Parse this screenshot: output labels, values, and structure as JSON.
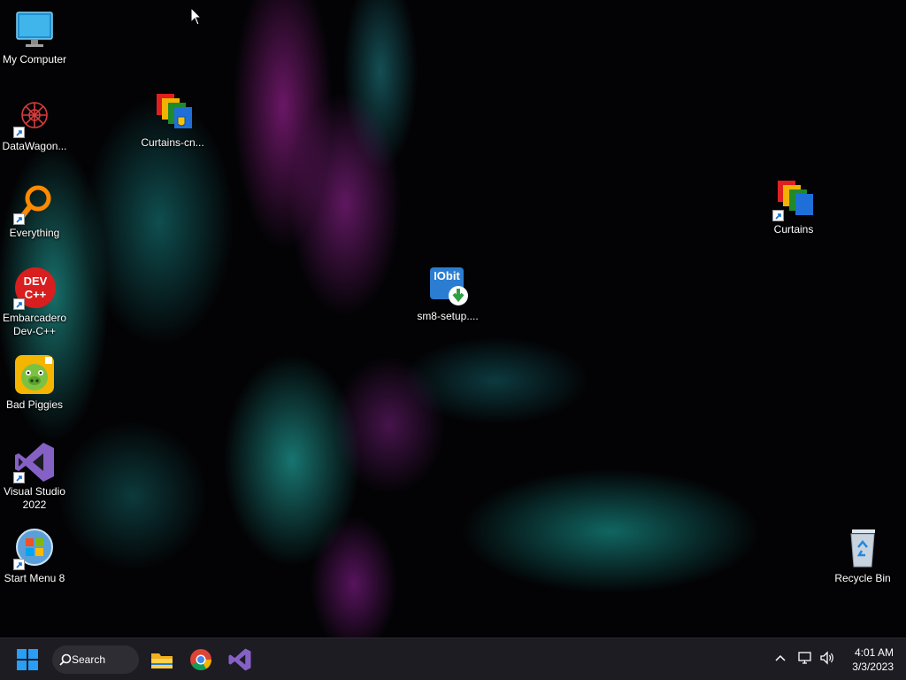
{
  "desktop": {
    "icons": [
      {
        "label": "My Computer",
        "icon": "monitor-icon"
      },
      {
        "label": "DataWagon...",
        "icon": "datawagon-icon"
      },
      {
        "label": "Everything",
        "icon": "everything-search-icon"
      },
      {
        "label": "Embarcadero Dev-C++",
        "icon": "devcpp-icon",
        "badge": "DEV C++"
      },
      {
        "label": "Bad Piggies",
        "icon": "bad-piggies-icon"
      },
      {
        "label": "Visual Studio 2022",
        "icon": "visual-studio-icon"
      },
      {
        "label": "Start Menu 8",
        "icon": "start-menu-8-icon"
      },
      {
        "label": "Curtains-cn...",
        "icon": "curtains-icon"
      },
      {
        "label": "sm8-setup....",
        "icon": "iobit-setup-icon",
        "badge": "IObit"
      },
      {
        "label": "Curtains",
        "icon": "curtains-icon"
      },
      {
        "label": "Recycle Bin",
        "icon": "recycle-bin-icon"
      }
    ]
  },
  "taskbar": {
    "search_label": "Search",
    "pinned": [
      "file-explorer-icon",
      "chrome-icon",
      "visual-studio-icon"
    ],
    "clock": {
      "time": "4:01 AM",
      "date": "3/3/2023"
    }
  },
  "colors": {
    "taskbar": "#1c1c22",
    "accent": "#0a84ff",
    "vs_purple": "#8661c5"
  }
}
